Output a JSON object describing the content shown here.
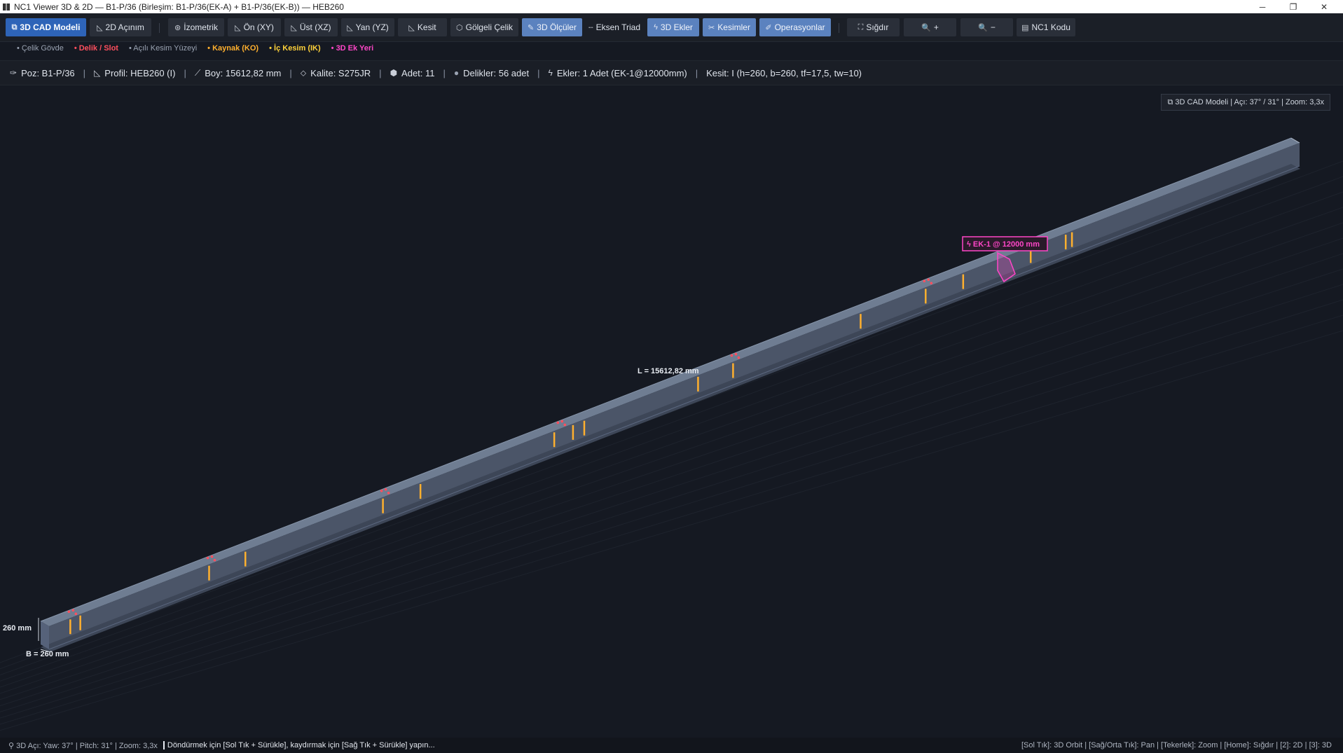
{
  "window": {
    "title": "NC1 Viewer 3D & 2D — B1-P/36 (Birleşim: B1-P/36(EK-A) + B1-P/36(EK-B)) — HEB260",
    "minimize": "─",
    "maximize": "❐",
    "close": "✕"
  },
  "toolbar": {
    "buttons": [
      {
        "icon": "⧉",
        "label": "3D CAD Modeli"
      },
      {
        "icon": "◺",
        "label": "2D Açınım"
      },
      {
        "icon": "⊛",
        "label": "İzometrik"
      },
      {
        "icon": "◺",
        "label": "Ön (XY)"
      },
      {
        "icon": "◺",
        "label": "Üst (XZ)"
      },
      {
        "icon": "◺",
        "label": "Yan (YZ)"
      },
      {
        "icon": "◺",
        "label": "Kesit"
      },
      {
        "icon": "⬡",
        "label": "Gölgeli Çelik"
      },
      {
        "icon": "✎",
        "label": "3D Ölçüler"
      },
      {
        "icon": "╌",
        "label": "Eksen Triad"
      },
      {
        "icon": "ϟ",
        "label": "3D Ekler"
      },
      {
        "icon": "✂",
        "label": "Kesimler"
      },
      {
        "icon": "✐",
        "label": "Operasyonlar"
      },
      {
        "icon": "⛶",
        "label": "Sığdır"
      },
      {
        "icon": "🔍",
        "label": "+"
      },
      {
        "icon": "🔍",
        "label": "−"
      },
      {
        "icon": "▤",
        "label": "NC1 Kodu"
      }
    ]
  },
  "legend": [
    {
      "label": "• Çelik Gövde",
      "color": "#9aa3b2"
    },
    {
      "label": "• Delik / Slot",
      "color": "#ff4f5e"
    },
    {
      "label": "• Açılı Kesim Yüzeyi",
      "color": "#9aa3b2"
    },
    {
      "label": "• Kaynak (KO)",
      "color": "#ffb02e"
    },
    {
      "label": "• İç Kesim (IK)",
      "color": "#ffd23a"
    },
    {
      "label": "• 3D Ek Yeri",
      "color": "#ff46c8"
    }
  ],
  "info": {
    "poz": "Poz: B1-P/36",
    "profil": "Profil: HEB260 (I)",
    "boy": "Boy: 15612,82 mm",
    "kalite": "Kalite: S275JR",
    "adet": "Adet: 11",
    "delikler": "Delikler: 56 adet",
    "ekler": "Ekler: 1 Adet (EK-1@12000mm)",
    "kesit": "Kesit: I (h=260, b=260, tf=17,5, tw=10)"
  },
  "view_badge": "⧉ 3D CAD Modeli   |   Açı: 37° / 31°   |   Zoom: 3,3x",
  "model": {
    "length_label": "L = 15612,82 mm",
    "height_label": "260 mm",
    "width_label": "B = 260 mm",
    "splice_label": "ϟ EK-1 @ 12000 mm",
    "colors": {
      "steel_top": "#6f7d92",
      "steel_web": "#4b5568",
      "steel_bottom": "#3a4354",
      "weld": "#ffb02e",
      "hole": "#ff4f5e",
      "splice": "#ff46c8"
    }
  },
  "status": {
    "left": "⚲ 3D Açı: Yaw: 37° | Pitch: 31° | Zoom: 3,3x",
    "middle": "Döndürmek için [Sol Tık + Sürükle], kaydırmak için [Sağ Tık + Sürükle] yapın...",
    "right": "[Sol Tık]: 3D Orbit  |  [Sağ/Orta Tık]: Pan  |  [Tekerlek]: Zoom  |  [Home]: Sığdır  |  [2]: 2D  |  [3]: 3D"
  }
}
